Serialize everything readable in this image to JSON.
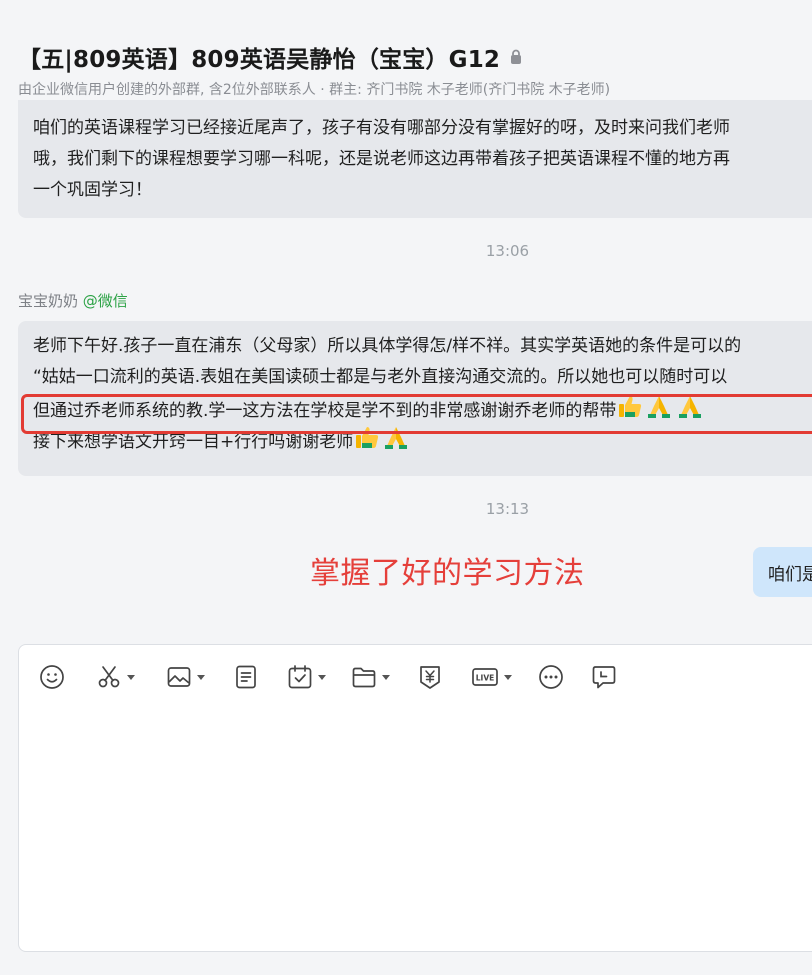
{
  "header": {
    "title": "【五|809英语】809英语吴静怡（宝宝）G12",
    "subtitle": "由企业微信用户创建的外部群, 含2位外部联系人 · 群主: 齐门书院 木子老师(齐门书院 木子老师)"
  },
  "messages": [
    {
      "lines": [
        "咱们的英语课程学习已经接近尾声了，孩子有没有哪部分没有掌握好的呀，及时来问我们老师",
        "哦，我们剩下的课程想要学习哪一科呢，还是说老师这边再带着孩子把英语课程不懂的地方再",
        "一个巩固学习！"
      ]
    },
    {
      "sender": "宝宝奶奶",
      "sender_tag": "@微信",
      "lines": [
        "老师下午好.孩子一直在浦东（父母家）所以具体学得怎/样不祥。其实学英语她的条件是可以的",
        "“姑姑一口流利的英语.表姐在美国读硕士都是与老外直接沟通交流的。所以她也可以随时可以",
        "但通过乔老师系统的教.学一这方法在学校是学不到的非常感谢谢乔老师的帮带",
        "接下来想学语文开窍一目+行行吗谢谢老师"
      ]
    }
  ],
  "timestamps": [
    "13:06",
    "13:13"
  ],
  "annotation": "掌握了好的学习方法",
  "self_message": "咱们是",
  "toolbar": {
    "icons": [
      "emoji-icon",
      "scissors-icon",
      "image-icon",
      "document-icon",
      "calendar-icon",
      "folder-icon",
      "payment-icon",
      "live-icon",
      "more-icon",
      "feedback-icon"
    ]
  },
  "colors": {
    "highlight": "#e23b33",
    "annotation": "#e53f3a",
    "self_bubble": "#cfe6fb",
    "wechat_tag": "#2ba245"
  }
}
